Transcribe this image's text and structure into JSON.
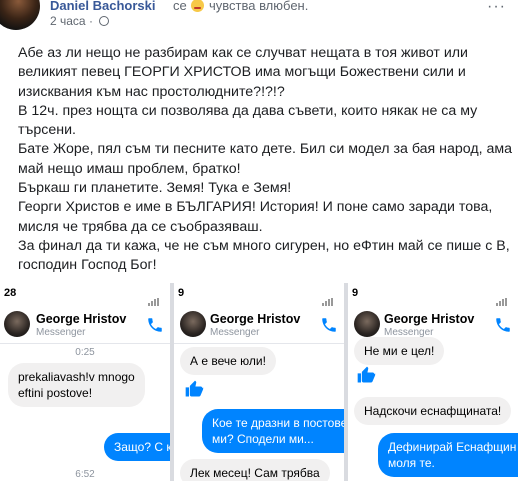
{
  "post": {
    "author": "Daniel Bachorski",
    "feeling_prefix": "се",
    "feeling_text": "чувства влюбен.",
    "time": "2 часа",
    "text_lines": [
      "Абе аз ли нещо не разбирам как се случват нещата в тоя живот или",
      "великият певец ГЕОРГИ ХРИСТОВ има могъщи Божествени сили и",
      "изисквания към нас простолюдните?!?!?",
      "В 12ч. през нощта си позволява да дава съвети, които някак не са му",
      "търсени.",
      "Бате Жоре, пял съм ти песните като дете. Бил си модел за бая народ, ама",
      "май нещо имаш проблем, братко!",
      "Бъркаш ги планетите. Земя! Тука е Земя!",
      "Георги Христов е име в БЪЛГАРИЯ! История! И поне само заради това,",
      "мисля че трябва да се съобразяваш.",
      "За финал да ти кажа, че не съм много сигурен, но еФтин май се пише с В,",
      "господин Господ Бог!"
    ]
  },
  "screenshots": [
    {
      "status_time": "28",
      "contact": "George Hristov",
      "subtitle": "Messenger",
      "messages": [
        {
          "kind": "time",
          "text": "0:25"
        },
        {
          "kind": "in",
          "lines": [
            "prekaliavash!v mnogo",
            "eftini postove!"
          ]
        },
        {
          "kind": "out",
          "text": "Защо? С ко"
        },
        {
          "kind": "time",
          "text": "6:52"
        }
      ]
    },
    {
      "status_time": "9",
      "contact": "George Hristov",
      "subtitle": "Messenger",
      "messages": [
        {
          "kind": "in",
          "text": "А е вече  юли!"
        },
        {
          "kind": "out",
          "lines": [
            "Кое те дразни в постове",
            "ми? Сподели ми..."
          ]
        },
        {
          "kind": "in",
          "text": "Лек месец! Сам трябва"
        }
      ]
    },
    {
      "status_time": "9",
      "contact": "George Hristov",
      "subtitle": "Messenger",
      "messages": [
        {
          "kind": "in",
          "text": "Не ми е цел!"
        },
        {
          "kind": "in",
          "text": "Надскочи еснафщината!"
        },
        {
          "kind": "out",
          "lines": [
            "Дефинирай Еснафщин",
            "моля те."
          ]
        }
      ]
    }
  ],
  "colors": {
    "link": "#385898",
    "messenger_blue": "#0084ff",
    "bubble_gray": "#f1f0f0"
  },
  "icons": {
    "call": "phone-icon",
    "like": "thumbs-up-icon"
  }
}
